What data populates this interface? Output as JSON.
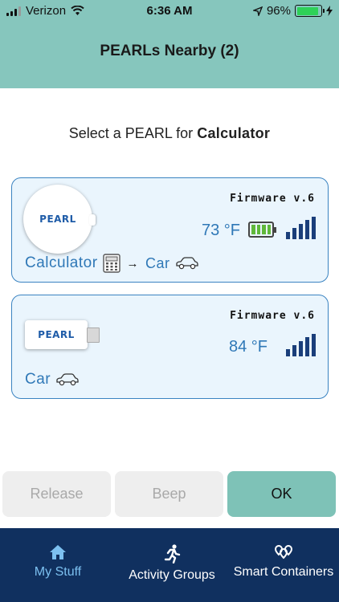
{
  "status_bar": {
    "carrier": "Verizon",
    "time": "6:36 AM",
    "battery_percent": "96%",
    "battery_level": 0.96
  },
  "header": {
    "title": "PEARLs Nearby (2)"
  },
  "prompt": {
    "prefix": "Select a PEARL for ",
    "target": "Calculator"
  },
  "devices": [
    {
      "logo": "PEARL",
      "firmware": "Firmware v.6",
      "temperature": "73 °F",
      "battery_level": 1.0,
      "signal_bars": 4,
      "assigned_name": "Calculator",
      "arrow": "→",
      "vehicle": "Car"
    },
    {
      "logo": "PEARL",
      "firmware": "Firmware v.6",
      "temperature": "84 °F",
      "signal_bars": 4,
      "vehicle": "Car"
    }
  ],
  "actions": {
    "release": "Release",
    "beep": "Beep",
    "ok": "OK"
  },
  "tabs": [
    {
      "label": "My Stuff",
      "icon": "home-icon",
      "active": true
    },
    {
      "label": "Activity Groups",
      "icon": "running-person-icon",
      "active": false
    },
    {
      "label": "Smart Containers",
      "icon": "smart-containers-icon",
      "active": false
    }
  ],
  "colors": {
    "header_bg": "#86c6bd",
    "card_bg": "#eaf5fd",
    "card_border": "#3a83c1",
    "accent_text": "#2f78b7",
    "tabbar_bg": "#10305f",
    "tab_active": "#7cc0f0"
  }
}
